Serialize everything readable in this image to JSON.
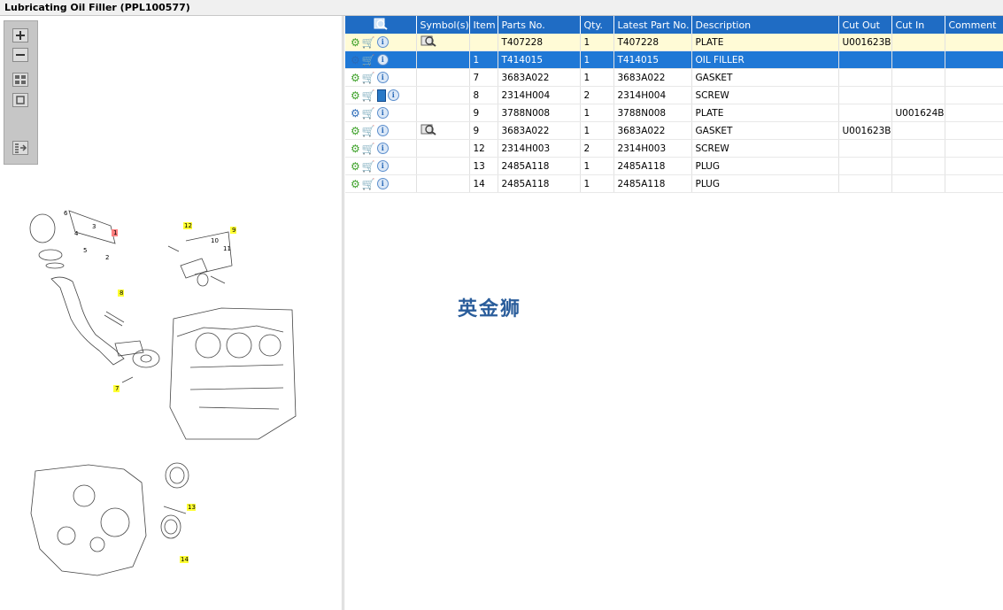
{
  "window": {
    "title": "Lubricating Oil Filler (PPL100577)"
  },
  "toolbar": {
    "buttons": [
      {
        "icon": "zoom-in-icon"
      },
      {
        "icon": "zoom-out-icon"
      },
      {
        "icon": "grid-view-icon"
      },
      {
        "icon": "single-view-icon"
      },
      {
        "icon": "list-export-icon"
      }
    ]
  },
  "diagram": {
    "callouts": [
      "1",
      "2",
      "3",
      "4",
      "5",
      "6",
      "7",
      "8",
      "9",
      "10",
      "11",
      "12",
      "13",
      "14"
    ]
  },
  "grid": {
    "columns": [
      "",
      "Symbol(s)",
      "Item",
      "Parts No.",
      "Qty.",
      "Latest Part No.",
      "Description",
      "Cut Out",
      "Cut In",
      "Comment"
    ],
    "rows": [
      {
        "icons": [
          "gear",
          "cart",
          "info"
        ],
        "symbol": "magnify",
        "item": "",
        "parts_no": "T407228",
        "qty": "1",
        "latest": "T407228",
        "desc": "PLATE",
        "cut_out": "U001623B",
        "cut_in": "",
        "comment": "",
        "style": "yellow"
      },
      {
        "icons": [
          "gear-multi",
          "cart",
          "info"
        ],
        "symbol": "",
        "item": "1",
        "parts_no": "T414015",
        "qty": "1",
        "latest": "T414015",
        "desc": "OIL FILLER",
        "cut_out": "",
        "cut_in": "",
        "comment": "",
        "style": "selected"
      },
      {
        "icons": [
          "gear",
          "cart",
          "info"
        ],
        "symbol": "",
        "item": "7",
        "parts_no": "3683A022",
        "qty": "1",
        "latest": "3683A022",
        "desc": "GASKET",
        "cut_out": "",
        "cut_in": "",
        "comment": "",
        "style": ""
      },
      {
        "icons": [
          "gear",
          "cart",
          "book",
          "info"
        ],
        "symbol": "",
        "item": "8",
        "parts_no": "2314H004",
        "qty": "2",
        "latest": "2314H004",
        "desc": "SCREW",
        "cut_out": "",
        "cut_in": "",
        "comment": "",
        "style": ""
      },
      {
        "icons": [
          "gear-multi",
          "cart",
          "info"
        ],
        "symbol": "",
        "item": "9",
        "parts_no": "3788N008",
        "qty": "1",
        "latest": "3788N008",
        "desc": "PLATE",
        "cut_out": "",
        "cut_in": "U001624B",
        "comment": "",
        "style": ""
      },
      {
        "icons": [
          "gear",
          "cart",
          "info"
        ],
        "symbol": "magnify",
        "item": "9",
        "parts_no": "3683A022",
        "qty": "1",
        "latest": "3683A022",
        "desc": "GASKET",
        "cut_out": "U001623B",
        "cut_in": "",
        "comment": "",
        "style": ""
      },
      {
        "icons": [
          "gear",
          "cart",
          "info"
        ],
        "symbol": "",
        "item": "12",
        "parts_no": "2314H003",
        "qty": "2",
        "latest": "2314H003",
        "desc": "SCREW",
        "cut_out": "",
        "cut_in": "",
        "comment": "",
        "style": ""
      },
      {
        "icons": [
          "gear",
          "cart",
          "info"
        ],
        "symbol": "",
        "item": "13",
        "parts_no": "2485A118",
        "qty": "1",
        "latest": "2485A118",
        "desc": "PLUG",
        "cut_out": "",
        "cut_in": "",
        "comment": "",
        "style": ""
      },
      {
        "icons": [
          "gear",
          "cart",
          "info"
        ],
        "symbol": "",
        "item": "14",
        "parts_no": "2485A118",
        "qty": "1",
        "latest": "2485A118",
        "desc": "PLUG",
        "cut_out": "",
        "cut_in": "",
        "comment": "",
        "style": ""
      }
    ]
  },
  "watermark": {
    "text": "英金狮"
  },
  "colors": {
    "header": "#1f6cc4",
    "selected_row": "#1f78d6",
    "highlight_row": "#fffbd6",
    "callout": "#ffff33",
    "callout_selected": "#ff8080"
  }
}
